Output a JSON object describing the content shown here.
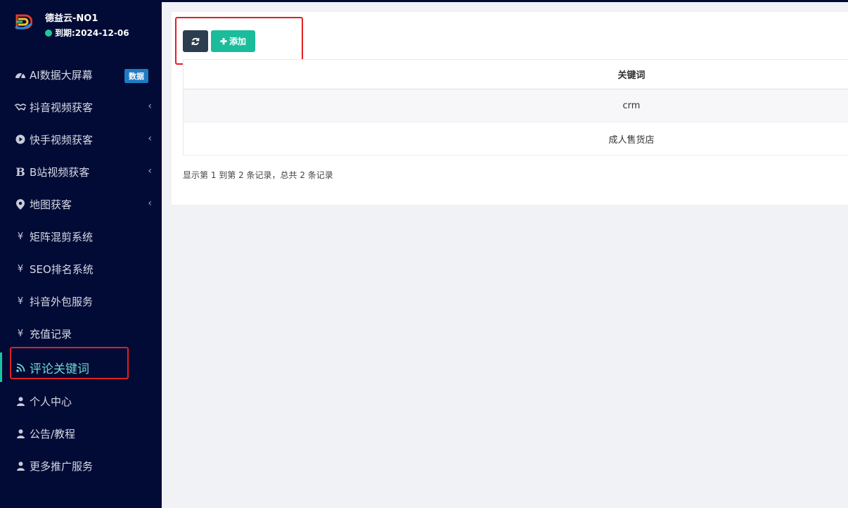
{
  "brand": {
    "name": "德益云-NO1",
    "expire": "到期:2024-12-06"
  },
  "menu": [
    {
      "icon": "dashboard-icon",
      "label": "AI数据大屏幕",
      "badge": "数据",
      "has_chevron": false
    },
    {
      "icon": "handshake-icon",
      "label": "抖音视频获客",
      "has_chevron": true
    },
    {
      "icon": "play-circle-icon",
      "label": "快手视频获客",
      "has_chevron": true
    },
    {
      "icon": "bold-b-icon",
      "label": "B站视频获客",
      "has_chevron": true
    },
    {
      "icon": "map-marker-icon",
      "label": "地图获客",
      "has_chevron": true
    },
    {
      "icon": "yen-icon",
      "label": "矩阵混剪系统",
      "has_chevron": false
    },
    {
      "icon": "yen-icon",
      "label": "SEO排名系统",
      "has_chevron": false
    },
    {
      "icon": "yen-icon",
      "label": "抖音外包服务",
      "has_chevron": false
    },
    {
      "icon": "yen-icon",
      "label": "充值记录",
      "has_chevron": false
    },
    {
      "icon": "rss-icon",
      "label": "评论关键词",
      "has_chevron": false,
      "active": true
    },
    {
      "icon": "user-icon",
      "label": "个人中心",
      "has_chevron": false
    },
    {
      "icon": "user-icon",
      "label": "公告/教程",
      "has_chevron": false
    },
    {
      "icon": "user-icon",
      "label": "更多推广服务",
      "has_chevron": false
    }
  ],
  "toolbar": {
    "refresh_icon": "refresh-icon",
    "add_label": "添加"
  },
  "table": {
    "columns": [
      "关键词"
    ],
    "rows": [
      [
        "crm"
      ],
      [
        "成人售货店"
      ]
    ]
  },
  "pagination": {
    "info": "显示第 1 到第 2 条记录，总共 2 条记录"
  },
  "colors": {
    "sidebar_bg": "#020b36",
    "accent": "#1bbc9b",
    "active_text": "#6fd6d0",
    "badge": "#1f7bc2",
    "highlight_box": "#e02020"
  }
}
